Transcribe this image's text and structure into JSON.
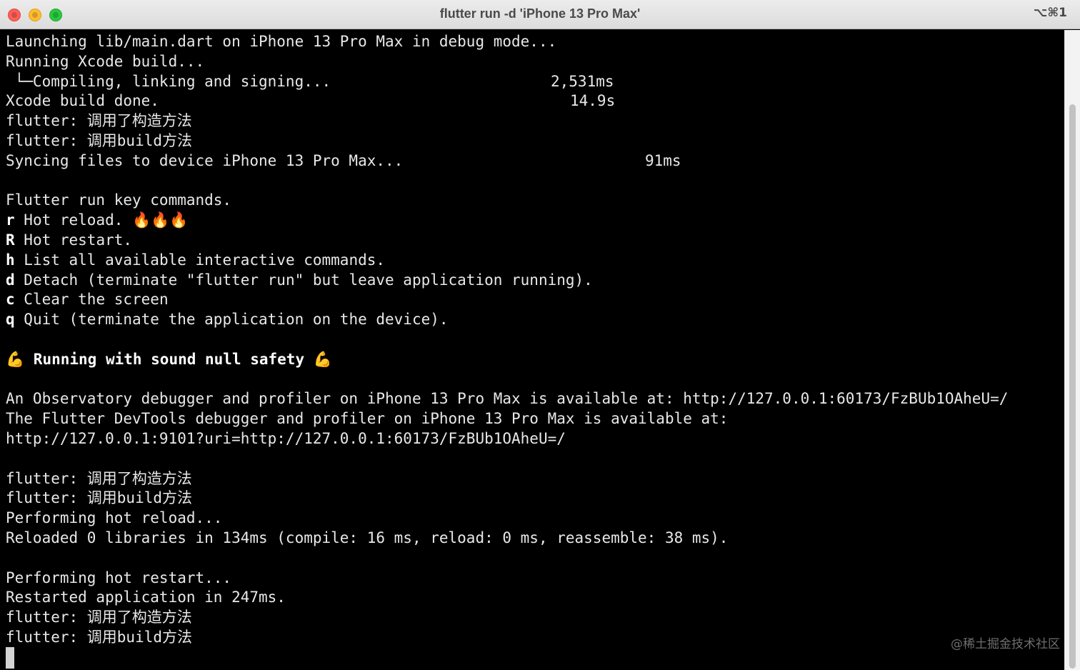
{
  "window": {
    "title": "flutter run -d 'iPhone 13 Pro Max'",
    "shortcut": "⌥⌘1"
  },
  "terminal": {
    "l1": "Launching lib/main.dart on iPhone 13 Pro Max in debug mode...",
    "l2": "Running Xcode build...",
    "l3": " └─Compiling, linking and signing...",
    "l3_time": "2,531ms",
    "l4": "Xcode build done.",
    "l4_time": "14.9s",
    "l5": "flutter: 调用了构造方法",
    "l6": "flutter: 调用build方法",
    "l7": "Syncing files to device iPhone 13 Pro Max...",
    "l7_time": "91ms",
    "l9": "Flutter run key commands.",
    "cmd_r_key": "r",
    "cmd_r_text": " Hot reload. ",
    "cmd_r_emoji": "🔥🔥🔥",
    "cmd_R_key": "R",
    "cmd_R_text": " Hot restart.",
    "cmd_h_key": "h",
    "cmd_h_text": " List all available interactive commands.",
    "cmd_d_key": "d",
    "cmd_d_text": " Detach (terminate \"flutter run\" but leave application running).",
    "cmd_c_key": "c",
    "cmd_c_text": " Clear the screen",
    "cmd_q_key": "q",
    "cmd_q_text": " Quit (terminate the application on the device).",
    "safety_emoji": "💪",
    "safety_text": " Running with sound null safety ",
    "obs_line": "An Observatory debugger and profiler on iPhone 13 Pro Max is available at: http://127.0.0.1:60173/FzBUb1OAheU=/",
    "devtools_line": "The Flutter DevTools debugger and profiler on iPhone 13 Pro Max is available at:",
    "devtools_url": "http://127.0.0.1:9101?uri=http://127.0.0.1:60173/FzBUb1OAheU=/",
    "l21": "flutter: 调用了构造方法",
    "l22": "flutter: 调用build方法",
    "l23": "Performing hot reload...",
    "l24": "Reloaded 0 libraries in 134ms (compile: 16 ms, reload: 0 ms, reassemble: 38 ms).",
    "l26": "Performing hot restart...",
    "l27": "Restarted application in 247ms.",
    "l28": "flutter: 调用了构造方法",
    "l29": "flutter: 调用build方法"
  },
  "watermark": "@稀土掘金技术社区"
}
